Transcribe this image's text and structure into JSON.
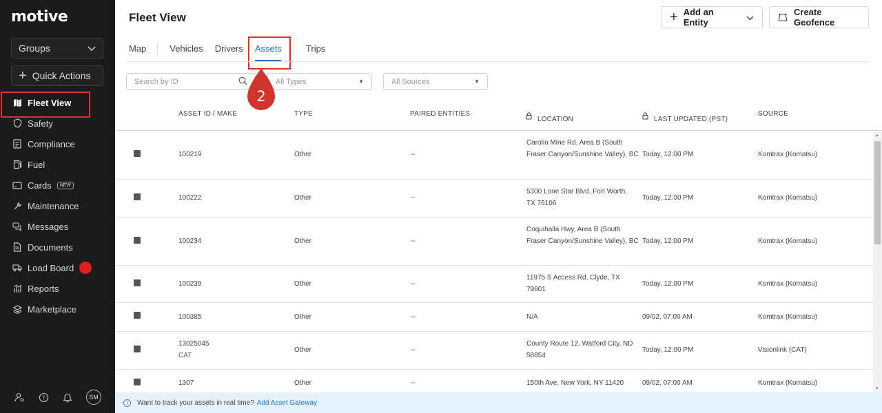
{
  "brand": {
    "logo_text": "motive"
  },
  "sidebar": {
    "groups_label": "Groups",
    "quick_actions_label": "Quick Actions",
    "items": [
      {
        "label": "Fleet View",
        "icon": "map-icon"
      },
      {
        "label": "Safety",
        "icon": "shield-icon"
      },
      {
        "label": "Compliance",
        "icon": "clipboard-icon"
      },
      {
        "label": "Fuel",
        "icon": "fuel-pump-icon"
      },
      {
        "label": "Cards",
        "icon": "card-icon",
        "badge": "NEW"
      },
      {
        "label": "Maintenance",
        "icon": "wrench-icon"
      },
      {
        "label": "Messages",
        "icon": "messages-icon"
      },
      {
        "label": "Documents",
        "icon": "document-icon"
      },
      {
        "label": "Load Board",
        "icon": "truck-icon"
      },
      {
        "label": "Reports",
        "icon": "reports-icon"
      },
      {
        "label": "Marketplace",
        "icon": "layers-icon"
      }
    ],
    "avatar_initials": "SM"
  },
  "header": {
    "title": "Fleet View",
    "add_entity_label": "Add an Entity",
    "create_geofence_label": "Create Geofence"
  },
  "tabs": [
    {
      "label": "Map"
    },
    {
      "label": "Vehicles"
    },
    {
      "label": "Drivers"
    },
    {
      "label": "Assets"
    },
    {
      "label": "Trips"
    }
  ],
  "filters": {
    "search_placeholder": "Search by ID",
    "types_placeholder": "All Types",
    "sources_placeholder": "All Sources"
  },
  "step_marker": "2",
  "table": {
    "columns": [
      "ASSET ID / MAKE",
      "TYPE",
      "PAIRED ENTITIES",
      "LOCATION",
      "LAST UPDATED (PST)",
      "SOURCE"
    ],
    "rows": [
      {
        "id": "100219",
        "make": "",
        "type": "Other",
        "paired": "--",
        "location": "Carolin Mine Rd, Area B (South Fraser Canyon/Sunshine Valley), BC",
        "updated": "Today, 12:00 PM",
        "source": "Komtrax (Komatsu)"
      },
      {
        "id": "100222",
        "make": "",
        "type": "Other",
        "paired": "--",
        "location": "5300 Lone Star Blvd, Fort Worth, TX 76106",
        "updated": "Today, 12:00 PM",
        "source": "Komtrax (Komatsu)"
      },
      {
        "id": "100234",
        "make": "",
        "type": "Other",
        "paired": "--",
        "location": "Coquihalla Hwy, Area B (South Fraser Canyon/Sunshine Valley), BC",
        "updated": "Today, 12:00 PM",
        "source": "Komtrax (Komatsu)"
      },
      {
        "id": "100239",
        "make": "",
        "type": "Other",
        "paired": "--",
        "location": "11975 S Access Rd, Clyde, TX 79601",
        "updated": "Today, 12:00 PM",
        "source": "Komtrax (Komatsu)"
      },
      {
        "id": "100385",
        "make": "",
        "type": "Other",
        "paired": "--",
        "location": "N/A",
        "updated": "09/02, 07:00 AM",
        "source": "Komtrax (Komatsu)"
      },
      {
        "id": "13025045",
        "make": "CAT",
        "type": "Other",
        "paired": "--",
        "location": "County Route 12, Watford City, ND 58854",
        "updated": "Today, 12:00 PM",
        "source": "Visionlink (CAT)"
      },
      {
        "id": "1307",
        "make": "",
        "type": "Other",
        "paired": "--",
        "location": "150th Ave, New York, NY 11420",
        "updated": "09/02, 07:00 AM",
        "source": "Komtrax (Komatsu)"
      }
    ]
  },
  "banner": {
    "text": "Want to track your assets in real time?",
    "link": "Add Asset Gateway"
  },
  "colors": {
    "accent": "#1a73d9",
    "highlight": "#d0342c",
    "sidebar_bg": "#1b1b1b"
  }
}
